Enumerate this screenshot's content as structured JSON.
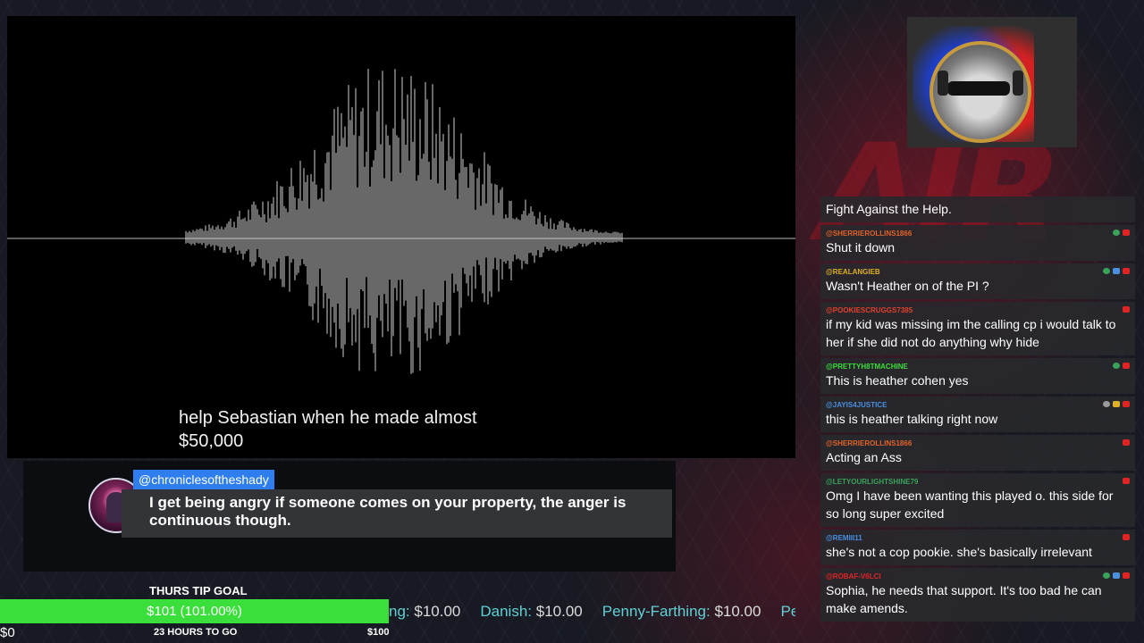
{
  "caption": {
    "line1": "help Sebastian when he made almost",
    "line2": "$50,000"
  },
  "featured_chat": {
    "username": "@chroniclesoftheshady",
    "message": "I get being angry if someone comes on your property, the anger is continuous though."
  },
  "tip_goal": {
    "title": "THURS TIP GOAL",
    "amount_label": "$101 (101.00%)",
    "progress_percent": 101,
    "min_label": "$0",
    "max_label": "$100",
    "time_left": "23 HOURS TO GO",
    "bar_color": "#3bdf3b"
  },
  "ticker": [
    {
      "name": "ng:",
      "amount": "$10.00"
    },
    {
      "name": "Danish:",
      "amount": "$10.00"
    },
    {
      "name": "Penny-Farthing:",
      "amount": "$10.00"
    },
    {
      "name": "Pei",
      "amount": ""
    }
  ],
  "chat": [
    {
      "user": "",
      "text": "Fight Against the Help.",
      "color": "#e05a2a",
      "badges": []
    },
    {
      "user": "@SHERRIEROLLINS1866",
      "text": "Shut it down",
      "color": "#e0632a",
      "badges": [
        "eye-icon",
        "youtube-icon"
      ]
    },
    {
      "user": "@REALANGIEB",
      "text": "Wasn't Heather on of the PI ?",
      "color": "#e0b024",
      "badges": [
        "eye-icon",
        "wrench-icon",
        "youtube-icon"
      ]
    },
    {
      "user": "@POOKIESCRUGGS7385",
      "text": "if my kid was missing im the calling cp i would talk to her if she did not do anything why hide",
      "color": "#e0402a",
      "badges": [
        "youtube-icon"
      ]
    },
    {
      "user": "@PRETTYH8TMACHINE",
      "text": "This is heather cohen yes",
      "color": "#3adf3a",
      "badges": [
        "eye-icon",
        "youtube-icon"
      ]
    },
    {
      "user": "@JAYIS4JUSTICE",
      "text": "this is heather talking right now",
      "color": "#4a8fe0",
      "badges": [
        "check-icon",
        "crown-icon",
        "youtube-icon"
      ]
    },
    {
      "user": "@SHERRIEROLLINS1866",
      "text": "Acting an Ass",
      "color": "#e0632a",
      "badges": [
        "youtube-icon"
      ]
    },
    {
      "user": "@LETYOURLIGHTSHINE79",
      "text": "Omg I have been wanting this played o. this side for so long super excited",
      "color": "#3aa35a",
      "badges": [
        "youtube-icon"
      ]
    },
    {
      "user": "@REMIII11",
      "text": "she's not a cop pookie. she's basically irrelevant",
      "color": "#4a8fe0",
      "badges": [
        "youtube-icon"
      ]
    },
    {
      "user": "@ROBAF-V6LCI",
      "text": "Sophia, he needs that support. It's too bad he can make amends.",
      "color": "#e02424",
      "badges": [
        "eye-icon",
        "wrench-icon",
        "youtube-icon"
      ]
    }
  ]
}
